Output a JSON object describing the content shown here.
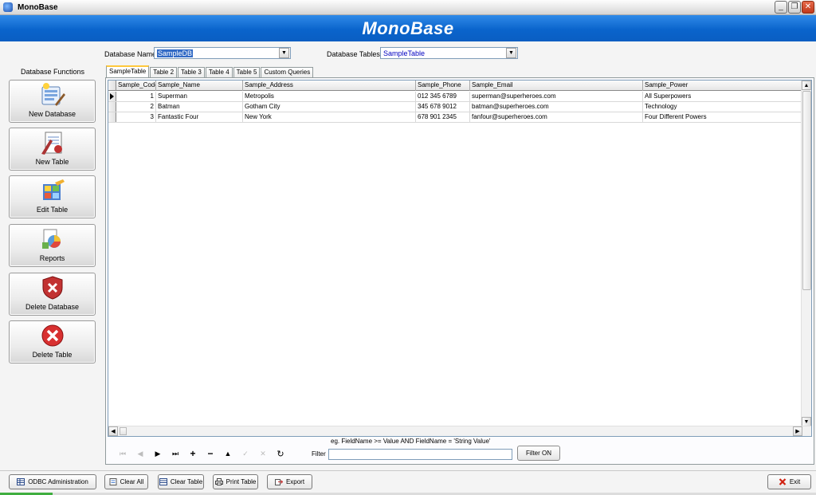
{
  "window": {
    "title": "MonoBase"
  },
  "banner": {
    "title": "MonoBase"
  },
  "selectors": {
    "database_name_label": "Database Name",
    "database_name_value": "SampleDB",
    "database_tables_label": "Database Tables",
    "database_tables_value": "SampleTable"
  },
  "sidebar": {
    "title": "Database Functions",
    "buttons": [
      {
        "label": "New Database",
        "icon": "new-database-icon"
      },
      {
        "label": "New Table",
        "icon": "new-table-icon"
      },
      {
        "label": "Edit Table",
        "icon": "edit-table-icon"
      },
      {
        "label": "Reports",
        "icon": "reports-icon"
      },
      {
        "label": "Delete Database",
        "icon": "delete-database-icon"
      },
      {
        "label": "Delete Table",
        "icon": "delete-table-icon"
      }
    ]
  },
  "tabs": [
    {
      "label": "SampleTable",
      "active": true
    },
    {
      "label": "Table 2"
    },
    {
      "label": "Table 3"
    },
    {
      "label": "Table 4"
    },
    {
      "label": "Table 5"
    },
    {
      "label": "Custom Queries"
    }
  ],
  "grid": {
    "columns": [
      "Sample_Code",
      "Sample_Name",
      "Sample_Address",
      "Sample_Phone",
      "Sample_Email",
      "Sample_Power"
    ],
    "rows": [
      [
        "1",
        "Superman",
        "Metropolis",
        "012 345 6789",
        "superman@superheroes.com",
        "All Superpowers"
      ],
      [
        "2",
        "Batman",
        "Gotham City",
        "345 678 9012",
        "batman@superheroes.com",
        "Technology"
      ],
      [
        "3",
        "Fantastic Four",
        "New York",
        "678 901 2345",
        "fanfour@superheroes.com",
        "Four Different Powers"
      ]
    ]
  },
  "navigator": {
    "filter_hint": "eg. FieldName >= Value AND FieldName = 'String Value'",
    "filter_label": "Filter",
    "filter_value": "",
    "filter_button": "Filter ON"
  },
  "toolbar": {
    "odbc": "ODBC Administration",
    "clear_all": "Clear All",
    "clear_table": "Clear Table",
    "print_table": "Print Table",
    "export": "Export",
    "exit": "Exit"
  },
  "colors": {
    "banner": "#0a64cc",
    "accent_tab": "#ffc83c",
    "selection": "#316ac5",
    "exit_icon": "#d02010"
  }
}
